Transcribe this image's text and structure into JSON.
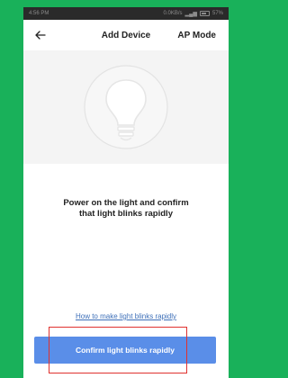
{
  "statusbar": {
    "time": "4:56 PM",
    "network": "0.0KB/s",
    "battery": "57%"
  },
  "header": {
    "title": "Add Device",
    "action_label": "AP Mode",
    "back_icon": "arrow-left-icon"
  },
  "illustration": {
    "icon": "light-bulb-icon"
  },
  "instruction": {
    "line1": "Power on the light and confirm",
    "line2": "that light blinks  rapidly"
  },
  "help_link": {
    "label": "How to make light blinks rapidly"
  },
  "confirm_button": {
    "label": "Confirm light blinks rapidly"
  },
  "colors": {
    "accent": "#5a8ee8",
    "link": "#3d6fb8",
    "highlight": "#e0322f",
    "frame": "#19b15a"
  }
}
